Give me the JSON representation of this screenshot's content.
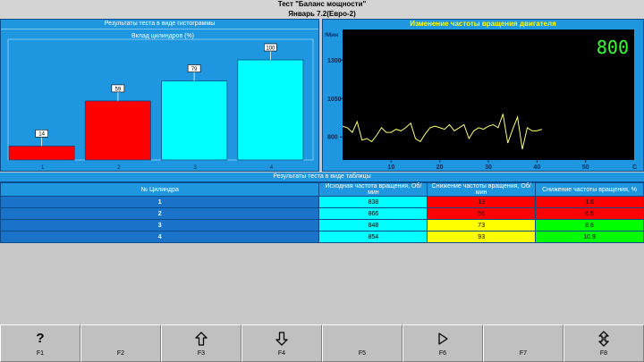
{
  "window": {
    "title": "Тест \"Баланс мощности\"",
    "subtitle": "Январь 7.2(Евро-2)"
  },
  "histogram": {
    "header": "Результаты теста в виде гистограммы",
    "chart_data": {
      "type": "bar",
      "title": "Вклад цилиндров (%)",
      "categories": [
        "1",
        "2",
        "3",
        "4"
      ],
      "values": [
        14,
        59,
        79,
        100
      ],
      "colors": [
        "#ff0000",
        "#ff0000",
        "#00ffff",
        "#00ffff"
      ],
      "ylim": [
        0,
        100
      ]
    }
  },
  "rpm": {
    "title": "Изменение частоты вращения двигателя",
    "unit_label": "/Мин",
    "x_unit": "С",
    "current_value": "800",
    "chart_data": {
      "type": "line",
      "xlim": [
        0,
        60
      ],
      "ylim": [
        650,
        1500
      ],
      "x_ticks": [
        10,
        20,
        30,
        40,
        50
      ],
      "y_ticks": [
        800,
        1050,
        1300
      ],
      "line_color": "#ffff66",
      "x": [
        0,
        1,
        2,
        3,
        4,
        5,
        6,
        7,
        8,
        9,
        10,
        11,
        12,
        13,
        14,
        15,
        16,
        17,
        18,
        19,
        20,
        21,
        22,
        23,
        24,
        25,
        26,
        27,
        28,
        29,
        30,
        31,
        32,
        33,
        34,
        35,
        36,
        37,
        38,
        39,
        40,
        41
      ],
      "y": [
        870,
        860,
        830,
        900,
        780,
        790,
        770,
        810,
        860,
        830,
        830,
        850,
        840,
        860,
        890,
        790,
        770,
        820,
        860,
        870,
        860,
        850,
        880,
        840,
        860,
        880,
        790,
        840,
        860,
        850,
        870,
        880,
        860,
        950,
        760,
        850,
        930,
        720,
        860,
        840,
        840,
        850
      ]
    }
  },
  "table": {
    "caption": "Результаты теста в виде таблицы",
    "headers": [
      "№ Цилиндра",
      "Исходная частота вращения, Об/мин",
      "Снижение частоты вращения, Об/мин",
      "Снижение частоты вращения, %"
    ],
    "rows": [
      {
        "cyl": "1",
        "initial": "838",
        "drop_rpm": "13",
        "drop_pct": "1.6"
      },
      {
        "cyl": "2",
        "initial": "866",
        "drop_rpm": "56",
        "drop_pct": "6.5"
      },
      {
        "cyl": "3",
        "initial": "848",
        "drop_rpm": "73",
        "drop_pct": "8.6"
      },
      {
        "cyl": "4",
        "initial": "854",
        "drop_rpm": "93",
        "drop_pct": "10.9"
      }
    ],
    "row_colors": {
      "drop_rpm": [
        "#ff0000",
        "#ff0000",
        "#ffff00",
        "#ffff00"
      ],
      "drop_pct": [
        "#ff0000",
        "#ff0000",
        "#00ff00",
        "#00ff00"
      ]
    }
  },
  "fkeys": [
    {
      "key": "F1",
      "icon": "help-icon",
      "glyph": "?"
    },
    {
      "key": "F2",
      "icon": "",
      "glyph": ""
    },
    {
      "key": "F3",
      "icon": "arrow-up-icon",
      "glyph": ""
    },
    {
      "key": "F4",
      "icon": "arrow-down-icon",
      "glyph": ""
    },
    {
      "key": "F5",
      "icon": "",
      "glyph": ""
    },
    {
      "key": "F6",
      "icon": "play-icon",
      "glyph": ""
    },
    {
      "key": "F7",
      "icon": "",
      "glyph": ""
    },
    {
      "key": "F8",
      "icon": "up-down-icon",
      "glyph": ""
    }
  ]
}
